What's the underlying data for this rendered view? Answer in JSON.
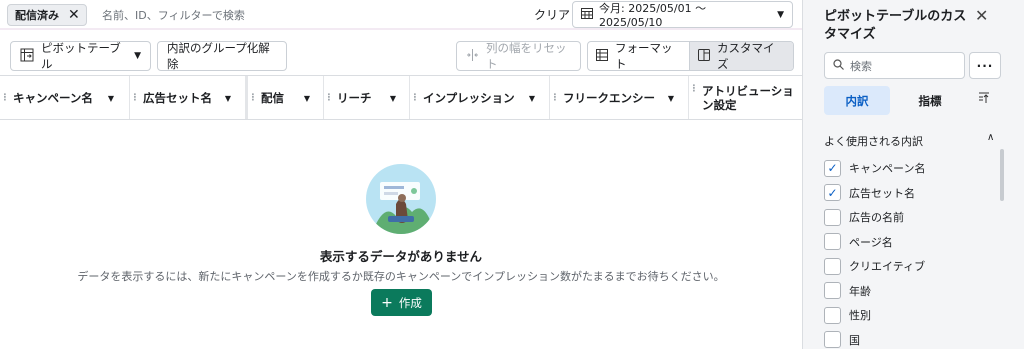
{
  "filterbar": {
    "chip_label": "配信済み",
    "placeholder": "名前、ID、フィルターで検索",
    "clear_label": "クリア",
    "date_label": "今月: 2025/05/01 ～ 2025/05/10"
  },
  "toolbar": {
    "pivot_label": "ピボットテーブル",
    "ungroup_label": "内訳のグループ化解除",
    "reset_width_label": "列の幅をリセット",
    "format_label": "フォーマット",
    "customize_label": "カスタマイズ"
  },
  "columns": [
    {
      "label": "キャンペーン名"
    },
    {
      "label": "広告セット名"
    },
    {
      "label": "配信"
    },
    {
      "label": "リーチ"
    },
    {
      "label": "インプレッション"
    },
    {
      "label": "フリークエンシー"
    },
    {
      "label": "アトリビューション設定"
    }
  ],
  "empty_state": {
    "title": "表示するデータがありません",
    "description": "データを表示するには、新たにキャンペーンを作成するか既存のキャンペーンでインプレッション数がたまるまでお待ちください。",
    "create_label": "作成"
  },
  "panel": {
    "title": "ピボットテーブルのカスタマイズ",
    "search_placeholder": "検索",
    "tabs": [
      {
        "label": "内訳"
      },
      {
        "label": "指標"
      }
    ],
    "section_label": "よく使用される内訳",
    "items": [
      {
        "label": "キャンペーン名",
        "checked": true
      },
      {
        "label": "広告セット名",
        "checked": true
      },
      {
        "label": "広告の名前",
        "checked": false
      },
      {
        "label": "ページ名",
        "checked": false
      },
      {
        "label": "クリエイティブ",
        "checked": false
      },
      {
        "label": "年齢",
        "checked": false
      },
      {
        "label": "性別",
        "checked": false
      },
      {
        "label": "国",
        "checked": false
      }
    ]
  },
  "colors": {
    "primary_button": "#0b7a5c",
    "active_tab": "#0a5fc4"
  },
  "icons": [
    "close-icon",
    "calendar-icon",
    "pivot-table-icon",
    "column-width-icon",
    "format-icon",
    "customize-icon",
    "search-icon",
    "more-icon",
    "sort-icon",
    "chevron-up-icon",
    "checkmark-icon",
    "plus-icon"
  ]
}
